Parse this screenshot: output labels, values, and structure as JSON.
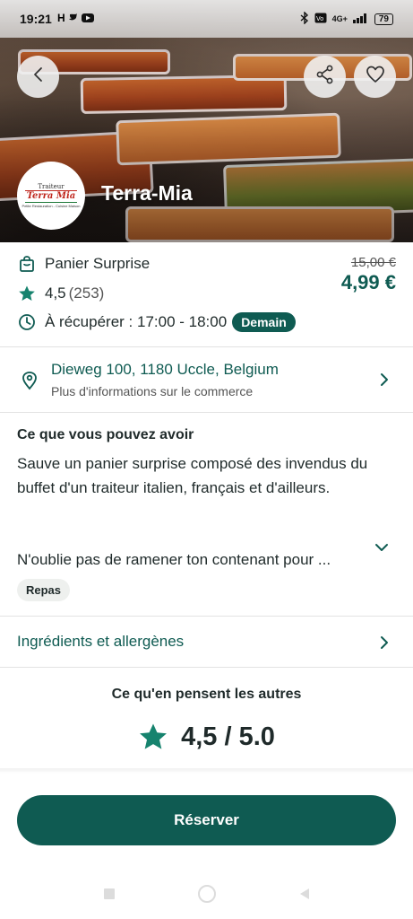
{
  "status_bar": {
    "time": "19:21",
    "network": "4G+",
    "battery": "79"
  },
  "header": {
    "store_name": "Terra-Mia",
    "logo": {
      "line1": "Traiteur",
      "line2": "Terra Mia",
      "line3": "Petite Restauration - Cuisine Maison"
    }
  },
  "offer": {
    "name": "Panier Surprise",
    "rating": "4,5",
    "rating_count": "(253)",
    "pickup": "À récupérer : 17:00 - 18:00",
    "pickup_badge": "Demain",
    "old_price": "15,00 €",
    "new_price": "4,99 €"
  },
  "address": {
    "line": "Dieweg 100, 1180 Uccle, Belgium",
    "sub": "Plus d'informations sur le commerce"
  },
  "description": {
    "title": "Ce que vous pouvez avoir",
    "body": "Sauve un panier surprise composé des invendus du buffet d'un traiteur italien, français et d'ailleurs.",
    "more": "N'oublie pas de ramener ton contenant pour ...",
    "tag": "Repas"
  },
  "ingredients": {
    "label": "Ingrédients et allergènes"
  },
  "reviews": {
    "title": "Ce qu'en pensent les autres",
    "score": "4,5 / 5.0"
  },
  "actions": {
    "reserve_label": "Réserver"
  },
  "colors": {
    "accent": "#0f5b52",
    "star": "#16836e"
  }
}
